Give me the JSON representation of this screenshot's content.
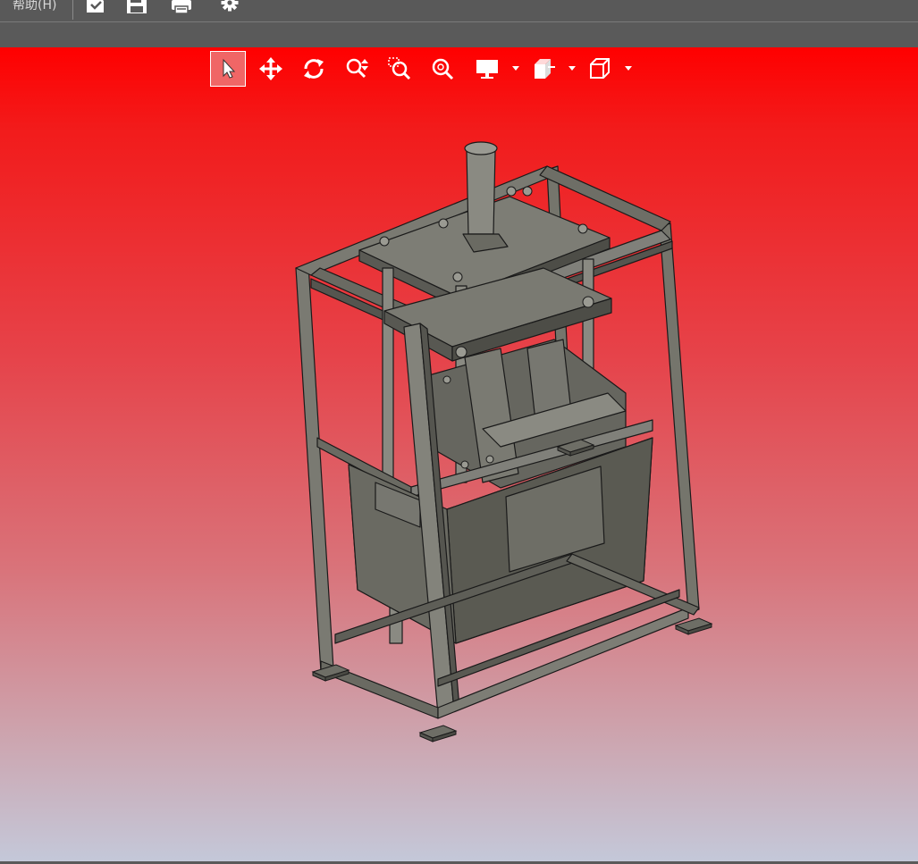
{
  "menubar": {
    "help_label": "帮助(H)",
    "icons": [
      "open-document-icon",
      "save-icon",
      "print-icon",
      "settings-gear-icon"
    ]
  },
  "toolbar": {
    "tools": [
      {
        "name": "select-tool",
        "icon": "arrow-cursor-icon",
        "active": true
      },
      {
        "name": "pan-tool",
        "icon": "four-way-move-icon",
        "active": false
      },
      {
        "name": "rotate-tool",
        "icon": "rotate-arrows-icon",
        "active": false
      },
      {
        "name": "zoom-tool",
        "icon": "zoom-updown-icon",
        "active": false
      },
      {
        "name": "zoom-window-tool",
        "icon": "zoom-window-icon",
        "active": false
      },
      {
        "name": "zoom-fit-tool",
        "icon": "zoom-fit-icon",
        "active": false
      },
      {
        "name": "display-mode-tool",
        "icon": "monitor-icon",
        "active": false,
        "dropdown": true
      },
      {
        "name": "section-tool",
        "icon": "section-cut-icon",
        "active": false,
        "dropdown": true
      },
      {
        "name": "view-cube-tool",
        "icon": "cube-view-icon",
        "active": false,
        "dropdown": true
      }
    ]
  },
  "viewport": {
    "background_top": "#ff0000",
    "background_bottom": "#c4c8d9",
    "model_color": "#6b6b63"
  }
}
